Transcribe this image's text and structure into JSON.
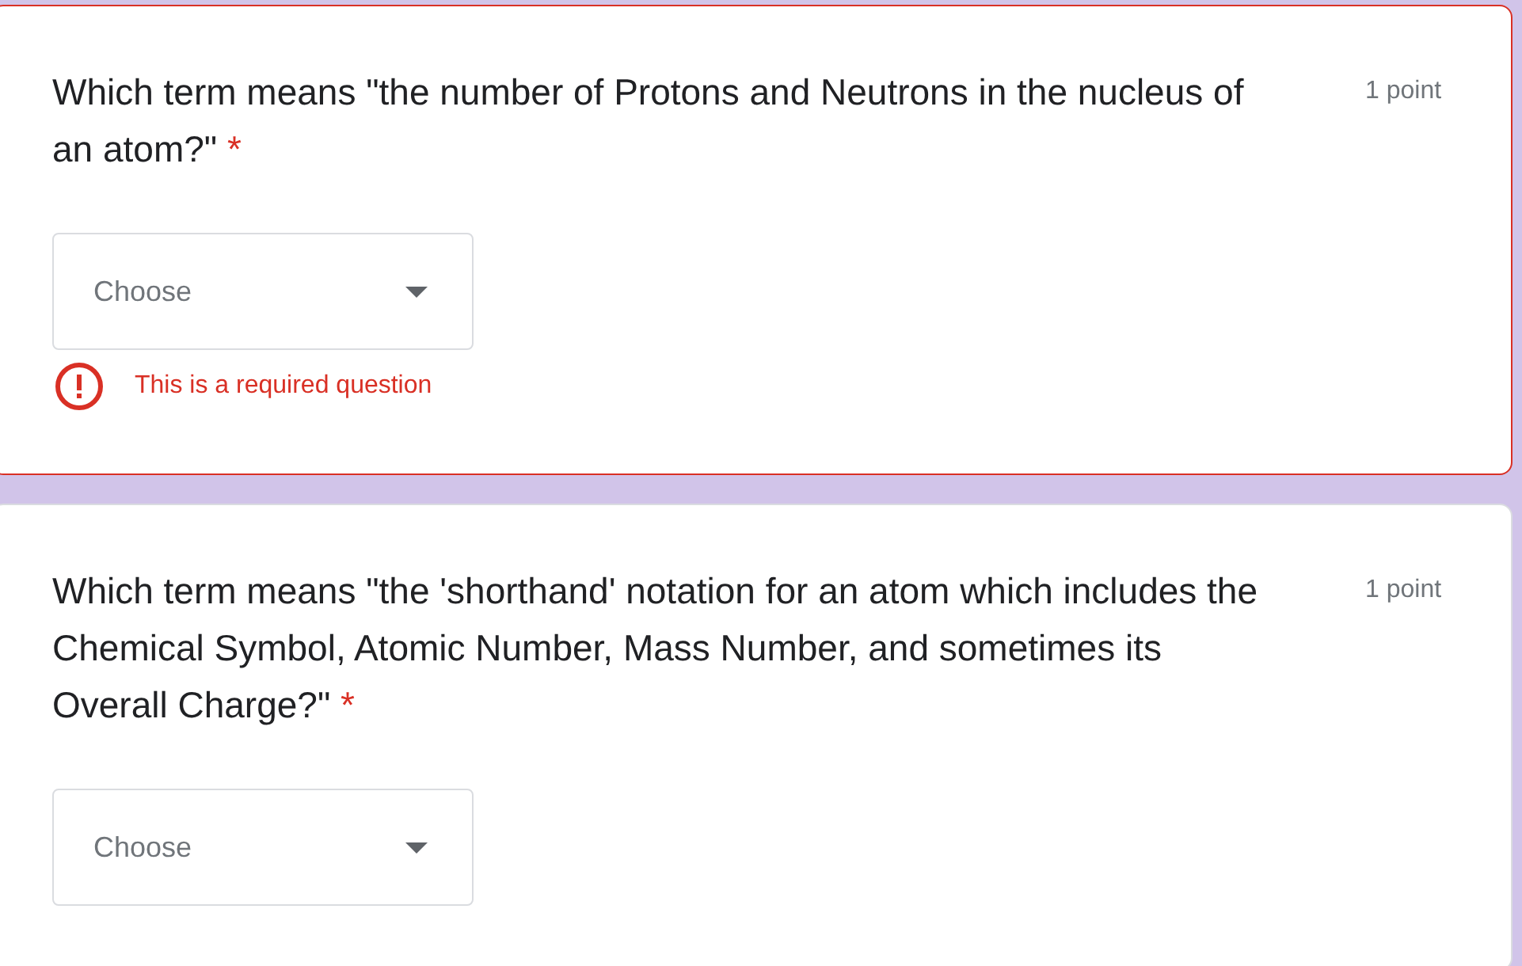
{
  "questions": [
    {
      "title": "Which term means \"the number of Protons and Neutrons in the nucleus of an atom?\"",
      "required_mark": "*",
      "points": "1 point",
      "invalid": true,
      "dropdown": {
        "placeholder": "Choose"
      },
      "error_message": "This is a required question"
    },
    {
      "title": "Which term means \"the 'shorthand' notation for an atom which includes the Chemical Symbol, Atomic Number, Mass Number, and sometimes its Overall Charge?\"",
      "required_mark": "*",
      "points": "1 point",
      "invalid": false,
      "dropdown": {
        "placeholder": "Choose"
      }
    }
  ]
}
